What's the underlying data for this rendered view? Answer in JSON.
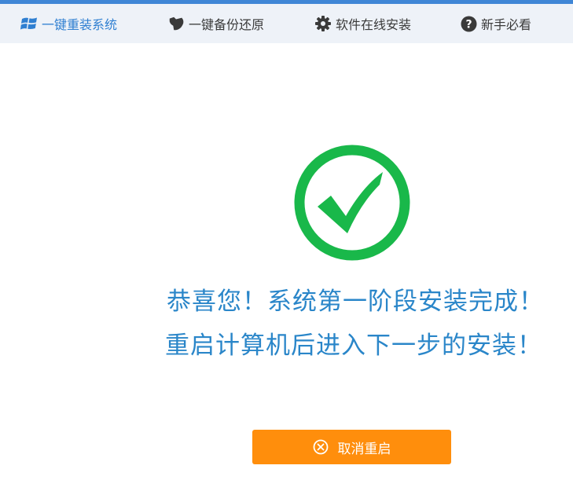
{
  "nav": {
    "items": [
      {
        "label": "一键重装系统",
        "icon": "windows-icon",
        "active": true
      },
      {
        "label": "一键备份还原",
        "icon": "backup-icon",
        "active": false
      },
      {
        "label": "软件在线安装",
        "icon": "gear-icon",
        "active": false
      },
      {
        "label": "新手必看",
        "icon": "help-icon",
        "active": false
      }
    ]
  },
  "status": {
    "line1": "恭喜您！系统第一阶段安装完成！",
    "line2": "重启计算机后进入下一步的安装！",
    "icon": "check-circle-icon"
  },
  "actions": {
    "cancel_label": "取消重启",
    "cancel_icon": "close-circle-icon"
  },
  "colors": {
    "accent": "#2f7fd1",
    "success": "#19b84a",
    "message": "#2a86c9",
    "button": "#ff8e0c"
  }
}
